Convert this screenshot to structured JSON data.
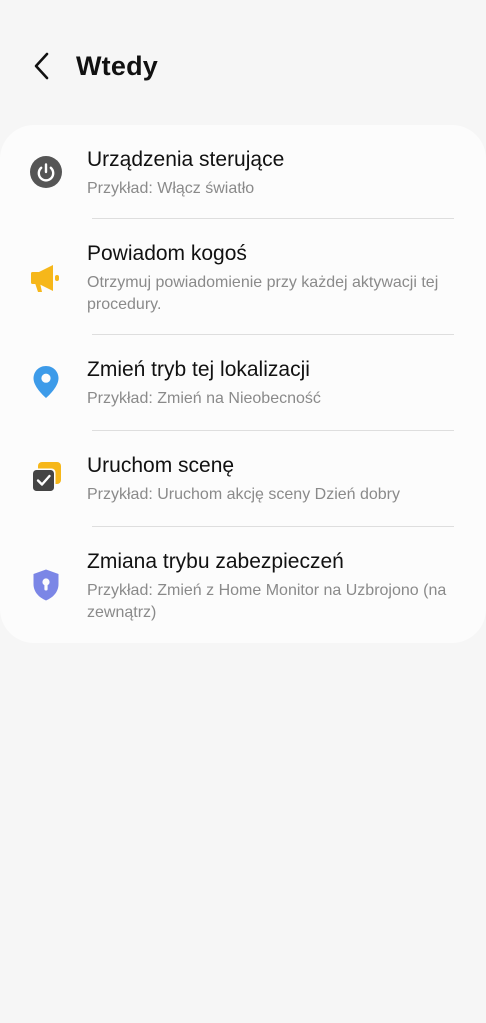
{
  "header": {
    "title": "Wtedy"
  },
  "items": [
    {
      "title": "Urządzenia sterujące",
      "subtitle": "Przykład: Włącz światło",
      "icon": "power-icon",
      "icon_color": "#555555"
    },
    {
      "title": "Powiadom kogoś",
      "subtitle": "Otrzymuj powiadomienie przy każdej aktywacji tej procedury.",
      "icon": "megaphone-icon",
      "icon_color": "#f6b71a"
    },
    {
      "title": "Zmień tryb tej lokalizacji",
      "subtitle": "Przykład: Zmień na Nieobecność",
      "icon": "location-pin-icon",
      "icon_color": "#3d9be9"
    },
    {
      "title": "Uruchom scenę",
      "subtitle": "Przykład: Uruchom akcję sceny Dzień dobry",
      "icon": "scene-icon",
      "icon_color": "#f6b71a"
    },
    {
      "title": "Zmiana trybu zabezpieczeń",
      "subtitle": "Przykład: Zmień z Home Monitor na Uzbrojono (na zewnątrz)",
      "icon": "security-shield-icon",
      "icon_color": "#7b86e6"
    }
  ]
}
